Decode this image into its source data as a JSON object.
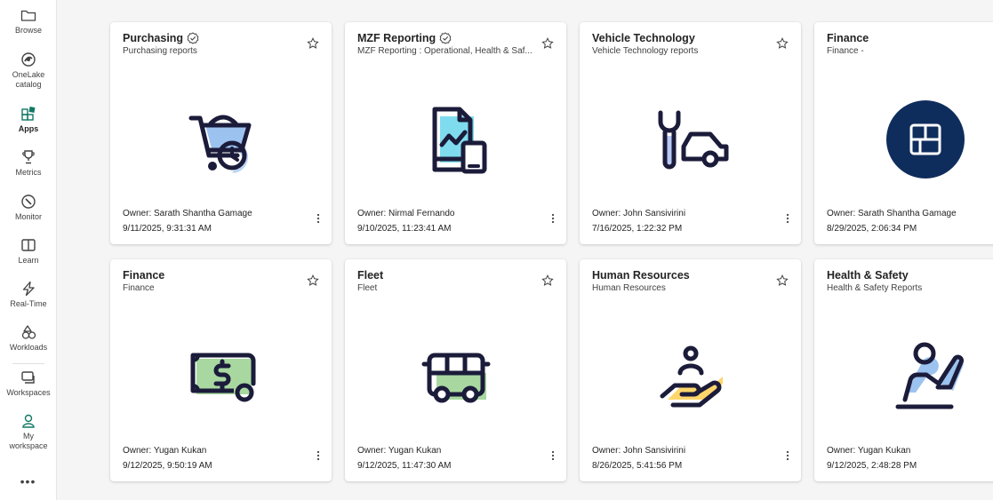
{
  "rail": {
    "items": [
      {
        "label": "Browse",
        "icon": "folder-icon"
      },
      {
        "label": "OneLake\ncatalog",
        "icon": "onelake-icon"
      },
      {
        "label": "Apps",
        "icon": "apps-icon",
        "active": true
      },
      {
        "label": "Metrics",
        "icon": "trophy-icon"
      },
      {
        "label": "Monitor",
        "icon": "monitor-icon"
      },
      {
        "label": "Learn",
        "icon": "book-icon"
      },
      {
        "label": "Real-Time",
        "icon": "lightning-icon"
      },
      {
        "label": "Workloads",
        "icon": "shapes-icon"
      },
      {
        "label": "Workspaces",
        "icon": "workspaces-icon"
      },
      {
        "label": "My\nworkspace",
        "icon": "person-icon"
      }
    ],
    "more": "•••"
  },
  "apps": [
    {
      "title": "Purchasing",
      "subtitle": "Purchasing reports",
      "verified": true,
      "owner": "Owner: Sarath Shantha Gamage",
      "date": "9/11/2025, 9:31:31 AM",
      "icon": "shopping-cart-icon"
    },
    {
      "title": "MZF Reporting",
      "subtitle": "MZF Reporting : Operational, Health & Saf...",
      "verified": true,
      "owner": "Owner: Nirmal Fernando",
      "date": "9/10/2025, 11:23:41 AM",
      "icon": "report-devices-icon"
    },
    {
      "title": "Vehicle Technology",
      "subtitle": "Vehicle Technology reports",
      "verified": false,
      "owner": "Owner: John Sansivirini",
      "date": "7/16/2025, 1:22:32 PM",
      "icon": "wrench-car-icon"
    },
    {
      "title": "Finance",
      "subtitle": "Finance -",
      "verified": false,
      "owner": "Owner: Sarath Shantha Gamage",
      "date": "8/29/2025, 2:06:34 PM",
      "icon": "app-logo-icon"
    },
    {
      "title": "Finance",
      "subtitle": "Finance",
      "verified": false,
      "owner": "Owner: Yugan Kukan",
      "date": "9/12/2025, 9:50:19 AM",
      "icon": "money-bill-icon"
    },
    {
      "title": "Fleet",
      "subtitle": "Fleet",
      "verified": false,
      "owner": "Owner: Yugan Kukan",
      "date": "9/12/2025, 11:47:30 AM",
      "icon": "bus-icon"
    },
    {
      "title": "Human Resources",
      "subtitle": "Human Resources",
      "verified": false,
      "owner": "Owner: John Sansivirini",
      "date": "8/26/2025, 5:41:56 PM",
      "icon": "hand-person-icon"
    },
    {
      "title": "Health & Safety",
      "subtitle": "Health & Safety Reports",
      "verified": false,
      "owner": "Owner: Yugan Kukan",
      "date": "9/12/2025, 2:48:28 PM",
      "icon": "person-raising-hand-icon"
    }
  ],
  "colors": {
    "accent_green": "#117865",
    "icon_stroke": "#1b1b3a",
    "blue_fill": "#9cc3f0",
    "cyan_fill": "#7fdcef",
    "green_fill": "#a8d8a0",
    "yellow_fill": "#ffd66b",
    "navy": "#0f2d5c"
  }
}
